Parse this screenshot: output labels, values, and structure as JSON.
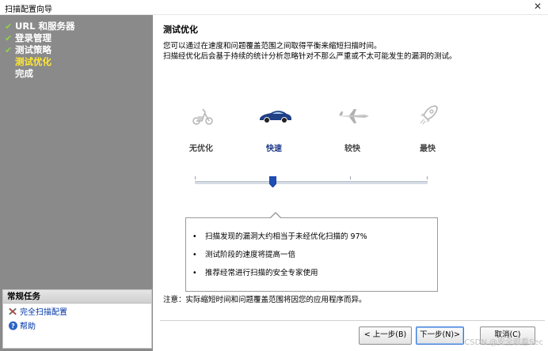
{
  "window": {
    "title": "扫描配置向导",
    "close_glyph": "✕"
  },
  "steps": [
    {
      "label": "URL 和服务器",
      "state": "done"
    },
    {
      "label": "登录管理",
      "state": "done"
    },
    {
      "label": "测试策略",
      "state": "done"
    },
    {
      "label": "测试优化",
      "state": "current"
    },
    {
      "label": "完成",
      "state": "pending"
    }
  ],
  "tasks": {
    "header": "常规任务",
    "items": [
      {
        "label": "完全扫描配置",
        "icon": "tools-icon"
      },
      {
        "label": "帮助",
        "icon": "help-icon"
      }
    ]
  },
  "main": {
    "title": "测试优化",
    "desc_line1": "您可以通过在速度和问题覆盖范围之间取得平衡来缩短扫描时间。",
    "desc_line2": "扫描经优化后会基于持续的统计分析忽略针对不那么严重或不太可能发生的漏洞的测试。"
  },
  "speed_options": [
    {
      "label": "无优化",
      "icon": "scooter-icon",
      "selected": false
    },
    {
      "label": "快速",
      "icon": "sports-car-icon",
      "selected": true
    },
    {
      "label": "较快",
      "icon": "jet-plane-icon",
      "selected": false
    },
    {
      "label": "最快",
      "icon": "rocket-icon",
      "selected": false
    }
  ],
  "slider": {
    "selected_index": 1,
    "positions": 4
  },
  "bullets": [
    "扫描发现的漏洞大约相当于未经优化扫描的 97%",
    "测试阶段的速度将提高一倍",
    "推荐经常进行扫描的安全专家使用"
  ],
  "note": "注意：实际缩短时间和问题覆盖范围将因您的应用程序而异。",
  "buttons": {
    "back": "< 上一步(B)",
    "next": "下一步(N)>",
    "cancel": "取消(C)"
  },
  "watermark": "CSDN @安全眼看Sec",
  "colors": {
    "sidebar": "#8a8a8a",
    "current_step": "#ffe833",
    "check": "#8fd14f",
    "selected_icon": "#1e3a8a",
    "slider_thumb": "#1f4fb5"
  }
}
